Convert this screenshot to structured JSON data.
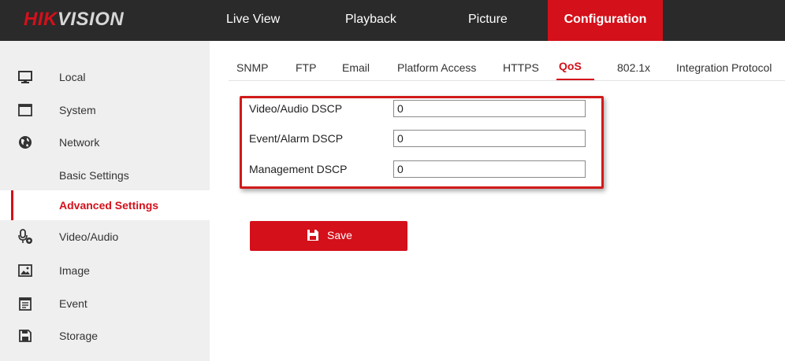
{
  "brand": {
    "part1": "HIK",
    "part2": "VISION"
  },
  "topnav": [
    {
      "label": "Live View"
    },
    {
      "label": "Playback"
    },
    {
      "label": "Picture"
    },
    {
      "label": "Configuration",
      "active": true
    }
  ],
  "sidebar": {
    "items": [
      {
        "label": "Local",
        "icon": "monitor-icon"
      },
      {
        "label": "System",
        "icon": "window-icon"
      },
      {
        "label": "Network",
        "icon": "globe-icon"
      },
      {
        "label": "Basic Settings"
      },
      {
        "label": "Advanced Settings",
        "selected": true
      },
      {
        "label": "Video/Audio",
        "icon": "microphone-gear-icon"
      },
      {
        "label": "Image",
        "icon": "image-icon"
      },
      {
        "label": "Event",
        "icon": "calendar-icon"
      },
      {
        "label": "Storage",
        "icon": "floppy-icon"
      }
    ]
  },
  "tabs": [
    {
      "label": "SNMP"
    },
    {
      "label": "FTP"
    },
    {
      "label": "Email"
    },
    {
      "label": "Platform Access"
    },
    {
      "label": "HTTPS"
    },
    {
      "label": "QoS",
      "active": true
    },
    {
      "label": "802.1x"
    },
    {
      "label": "Integration Protocol"
    }
  ],
  "form": {
    "video_audio_dscp": {
      "label": "Video/Audio DSCP",
      "value": "0"
    },
    "event_alarm_dscp": {
      "label": "Event/Alarm DSCP",
      "value": "0"
    },
    "management_dscp": {
      "label": "Management DSCP",
      "value": "0"
    }
  },
  "save_button": {
    "label": "Save",
    "icon": "floppy-icon"
  },
  "colors": {
    "accent": "#d4101a",
    "topbar": "#2a2a2a",
    "sidebar": "#efefef",
    "highlight": "#d11a1a"
  }
}
